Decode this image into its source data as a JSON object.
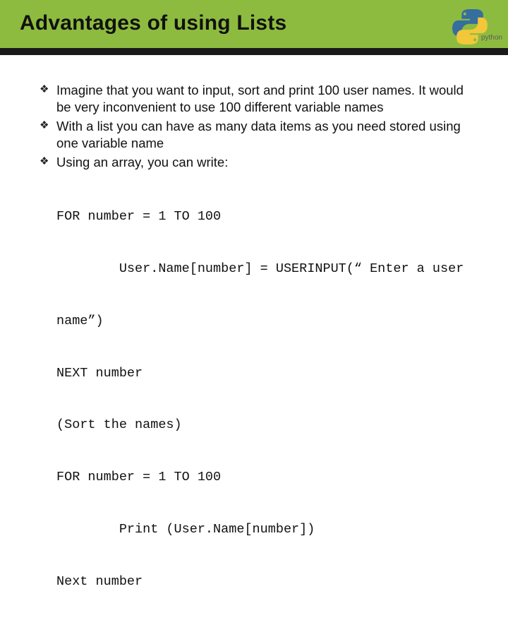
{
  "header": {
    "title": "Advantages of using Lists",
    "logo_alt": "python"
  },
  "bullets": [
    "Imagine that you want to input, sort and print 100 user names. It would be very inconvenient to use 100 different variable names",
    "With a list you can have as many data items as you need stored using one variable name",
    "Using an array, you can write:"
  ],
  "code": [
    "FOR number = 1 TO 100",
    "        User.Name[number] = USERINPUT(“ Enter a user ",
    "name”)",
    "NEXT number",
    "(Sort the names)",
    "FOR number = 1 TO 100",
    "        Print (User.Name[number])",
    "Next number"
  ]
}
